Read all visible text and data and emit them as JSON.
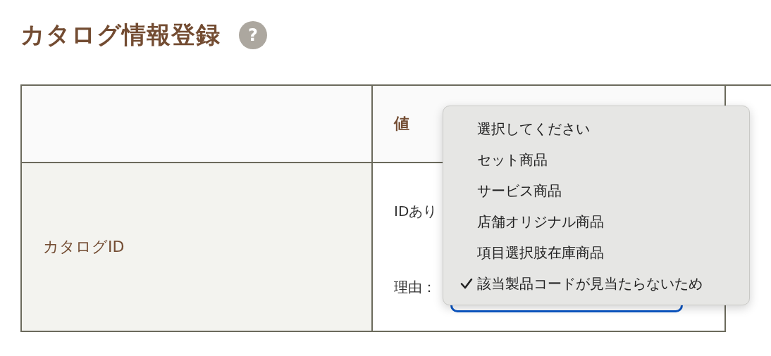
{
  "page": {
    "title": "カタログ情報登録",
    "help_icon": "?"
  },
  "table": {
    "header_2": "値",
    "rows": [
      {
        "label": "カタログID",
        "id_text": "IDあり",
        "reason_label": "理由："
      }
    ]
  },
  "dropdown": {
    "options": [
      {
        "label": "選択してください",
        "selected": false
      },
      {
        "label": "セット商品",
        "selected": false
      },
      {
        "label": "サービス商品",
        "selected": false
      },
      {
        "label": "店舗オリジナル商品",
        "selected": false
      },
      {
        "label": "項目選択肢在庫商品",
        "selected": false
      },
      {
        "label": "該当製品コードが見当たらないため",
        "selected": true
      }
    ]
  }
}
